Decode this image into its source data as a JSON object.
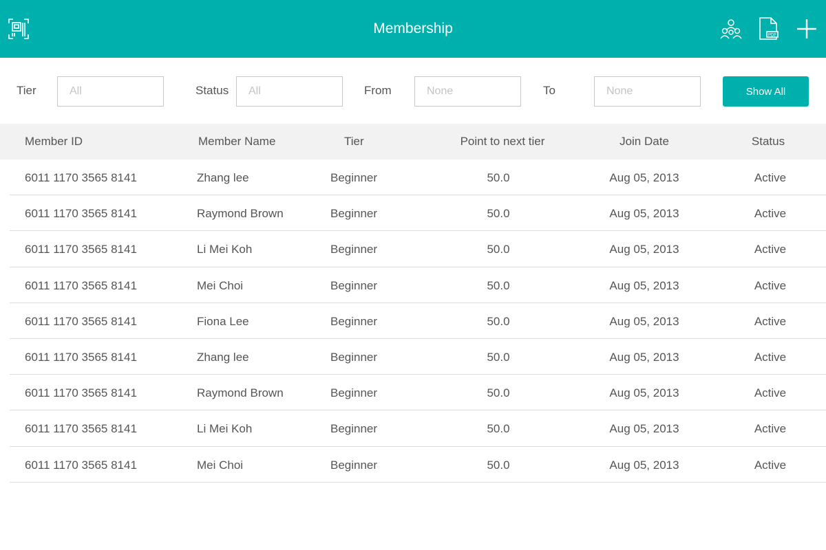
{
  "header": {
    "title": "Membership",
    "left_icon": "barcode-scan-icon",
    "right_icons": [
      "group-icon",
      "pdf-file-icon",
      "plus-icon"
    ],
    "background": "#00b0ad"
  },
  "filters": {
    "tier_label": "Tier",
    "tier_placeholder": "All",
    "status_label": "Status",
    "status_placeholder": "All",
    "from_label": "From",
    "from_placeholder": "None",
    "to_label": "To",
    "to_placeholder": "None",
    "show_all_label": "Show All"
  },
  "table": {
    "columns": [
      "Member ID",
      "Member Name",
      "Tier",
      "Point to next tier",
      "Join Date",
      "Status"
    ],
    "rows": [
      [
        "6011 1170 3565 8141",
        "Zhang lee",
        "Beginner",
        "50.0",
        "Aug 05, 2013",
        "Active"
      ],
      [
        "6011 1170 3565 8141",
        "Raymond Brown",
        "Beginner",
        "50.0",
        "Aug 05, 2013",
        "Active"
      ],
      [
        "6011 1170 3565 8141",
        "Li Mei Koh",
        "Beginner",
        "50.0",
        "Aug 05, 2013",
        "Active"
      ],
      [
        "6011 1170 3565 8141",
        "Mei Choi",
        "Beginner",
        "50.0",
        "Aug 05, 2013",
        "Active"
      ],
      [
        "6011 1170 3565 8141",
        "Fiona Lee",
        "Beginner",
        "50.0",
        "Aug 05, 2013",
        "Active"
      ],
      [
        "6011 1170 3565 8141",
        "Zhang lee",
        "Beginner",
        "50.0",
        "Aug 05, 2013",
        "Active"
      ],
      [
        "6011 1170 3565 8141",
        "Raymond Brown",
        "Beginner",
        "50.0",
        "Aug 05, 2013",
        "Active"
      ],
      [
        "6011 1170 3565 8141",
        "Li Mei Koh",
        "Beginner",
        "50.0",
        "Aug 05, 2013",
        "Active"
      ],
      [
        "6011 1170 3565 8141",
        "Mei Choi",
        "Beginner",
        "50.0",
        "Aug 05, 2013",
        "Active"
      ]
    ]
  }
}
